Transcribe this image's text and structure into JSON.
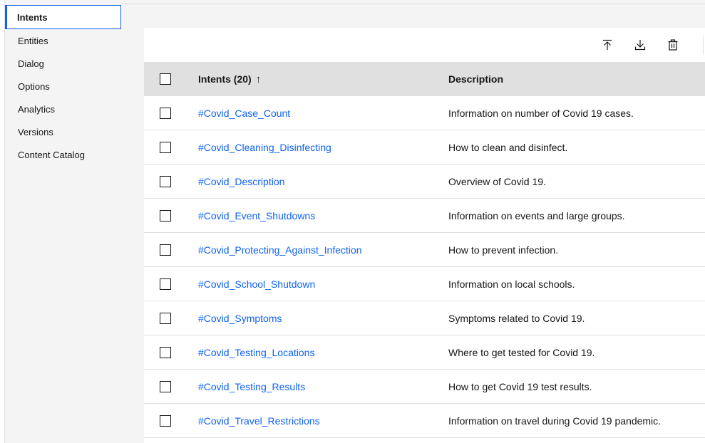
{
  "sidebar": {
    "items": [
      {
        "label": "Intents",
        "active": true
      },
      {
        "label": "Entities"
      },
      {
        "label": "Dialog"
      },
      {
        "label": "Options"
      },
      {
        "label": "Analytics"
      },
      {
        "label": "Versions"
      },
      {
        "label": "Content Catalog"
      }
    ]
  },
  "toolbar": {
    "icons": [
      "upload-icon",
      "download-icon",
      "delete-icon"
    ]
  },
  "table": {
    "header": {
      "name": "Intents (20)",
      "sort_icon": "↑",
      "description": "Description"
    },
    "rows": [
      {
        "name": "#Covid_Case_Count",
        "description": "Information on number of Covid 19 cases."
      },
      {
        "name": "#Covid_Cleaning_Disinfecting",
        "description": "How to clean and disinfect."
      },
      {
        "name": "#Covid_Description",
        "description": "Overview of Covid 19."
      },
      {
        "name": "#Covid_Event_Shutdowns",
        "description": "Information on events and large groups."
      },
      {
        "name": "#Covid_Protecting_Against_Infection",
        "description": "How to prevent infection."
      },
      {
        "name": "#Covid_School_Shutdown",
        "description": "Information on local schools."
      },
      {
        "name": "#Covid_Symptoms",
        "description": "Symptoms related to Covid 19."
      },
      {
        "name": "#Covid_Testing_Locations",
        "description": "Where to get tested for Covid 19."
      },
      {
        "name": "#Covid_Testing_Results",
        "description": "How to get Covid 19 test results."
      },
      {
        "name": "#Covid_Travel_Restrictions",
        "description": "Information on travel during Covid 19 pandemic."
      }
    ]
  },
  "colors": {
    "link": "#0f62fe",
    "header_bg": "#e0e0e0",
    "page_bg": "#f4f4f4"
  }
}
